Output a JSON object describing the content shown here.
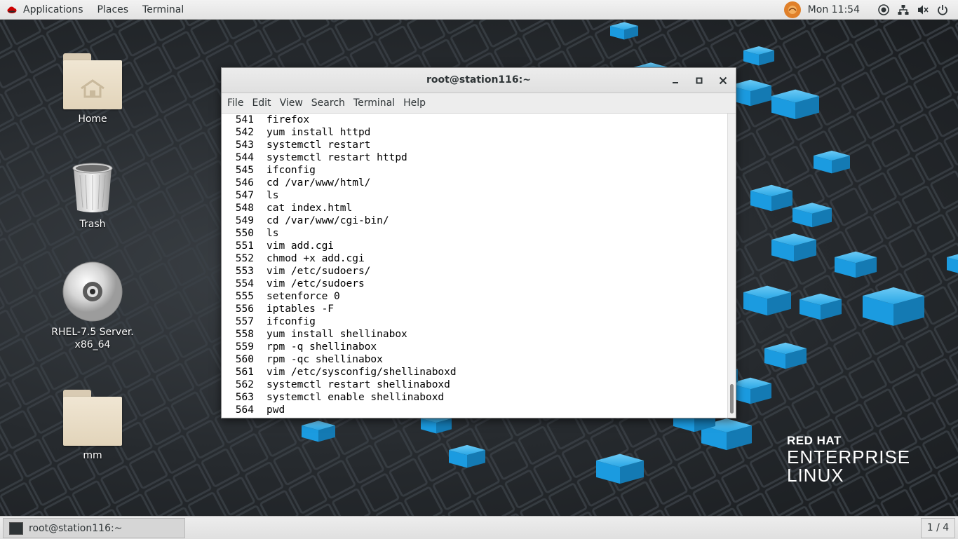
{
  "topbar": {
    "applications": "Applications",
    "places": "Places",
    "terminal": "Terminal",
    "clock": "Mon 11:54"
  },
  "desktop_icons": [
    {
      "label": "Home",
      "icon": "home-folder-icon"
    },
    {
      "label": "Trash",
      "icon": "trash-icon"
    },
    {
      "label": "RHEL-7.5 Server.",
      "label2": "x86_64",
      "icon": "optical-disc-icon"
    },
    {
      "label": "mm",
      "icon": "folder-icon"
    }
  ],
  "window": {
    "title": "root@station116:~",
    "menu": [
      "File",
      "Edit",
      "View",
      "Search",
      "Terminal",
      "Help"
    ]
  },
  "terminal_lines": [
    {
      "n": "541",
      "cmd": "firefox"
    },
    {
      "n": "542",
      "cmd": "yum install httpd"
    },
    {
      "n": "543",
      "cmd": "systemctl restart"
    },
    {
      "n": "544",
      "cmd": "systemctl restart httpd"
    },
    {
      "n": "545",
      "cmd": "ifconfig"
    },
    {
      "n": "546",
      "cmd": "cd /var/www/html/"
    },
    {
      "n": "547",
      "cmd": "ls"
    },
    {
      "n": "548",
      "cmd": "cat index.html"
    },
    {
      "n": "549",
      "cmd": "cd /var/www/cgi-bin/"
    },
    {
      "n": "550",
      "cmd": "ls"
    },
    {
      "n": "551",
      "cmd": "vim add.cgi"
    },
    {
      "n": "552",
      "cmd": "chmod +x add.cgi"
    },
    {
      "n": "553",
      "cmd": "vim /etc/sudoers/"
    },
    {
      "n": "554",
      "cmd": "vim /etc/sudoers"
    },
    {
      "n": "555",
      "cmd": "setenforce 0"
    },
    {
      "n": "556",
      "cmd": "iptables -F"
    },
    {
      "n": "557",
      "cmd": "ifconfig"
    },
    {
      "n": "558",
      "cmd": "yum install shellinabox"
    },
    {
      "n": "559",
      "cmd": "rpm -q shellinabox"
    },
    {
      "n": "560",
      "cmd": "rpm -qc shellinabox"
    },
    {
      "n": "561",
      "cmd": "vim /etc/sysconfig/shellinaboxd"
    },
    {
      "n": "562",
      "cmd": "systemctl restart shellinaboxd"
    },
    {
      "n": "563",
      "cmd": "systemctl enable shellinaboxd"
    },
    {
      "n": "564",
      "cmd": "pwd"
    }
  ],
  "branding": {
    "line1": "RED HAT",
    "line2": "ENTERPRISE",
    "line3": "LINUX"
  },
  "taskbar": {
    "window_label": "root@station116:~",
    "workspace": "1 / 4"
  },
  "colors": {
    "cube_blue": "#1b9be0",
    "rh_red": "#cc0000"
  }
}
